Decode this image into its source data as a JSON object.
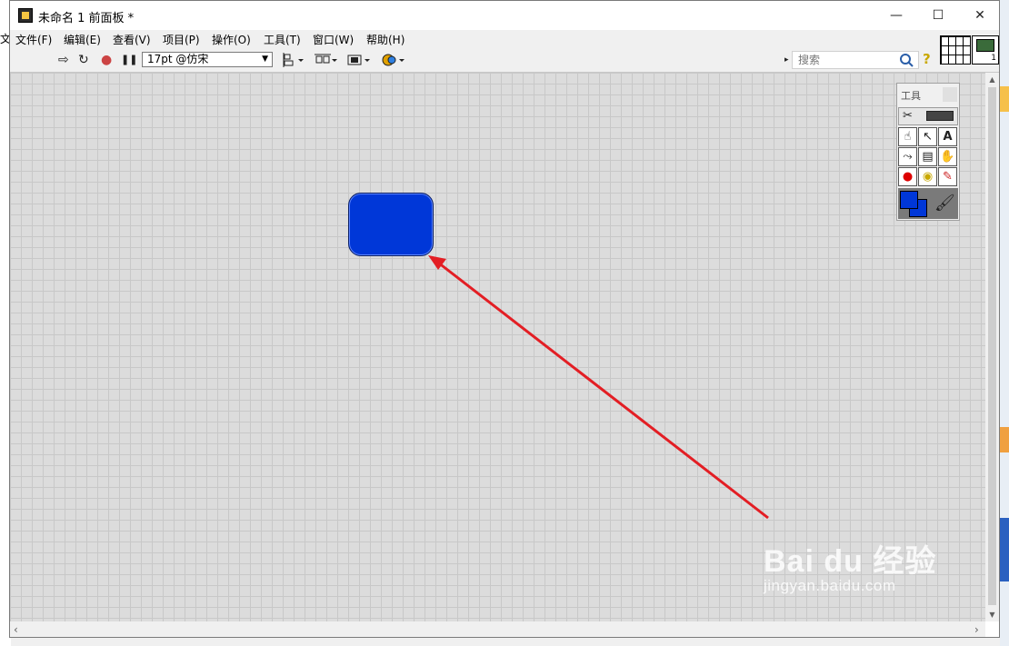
{
  "window": {
    "title": "未命名 1 前面板 *",
    "controls": {
      "minimize": "—",
      "maximize": "☐",
      "close": "✕"
    }
  },
  "menubar": {
    "items": [
      {
        "label": "文件(F)"
      },
      {
        "label": "编辑(E)"
      },
      {
        "label": "查看(V)"
      },
      {
        "label": "项目(P)"
      },
      {
        "label": "操作(O)"
      },
      {
        "label": "工具(T)"
      },
      {
        "label": "窗口(W)"
      },
      {
        "label": "帮助(H)"
      }
    ]
  },
  "toolbar": {
    "run_icon": "⇨",
    "run_continuous_icon": "↻",
    "abort_icon": "●",
    "pause_icon": "❚❚",
    "font_select": "17pt @仿宋",
    "align_icon": "align-objects-icon",
    "distribute_icon": "distribute-objects-icon",
    "resize_icon": "resize-objects-icon",
    "reorder_icon": "reorder-icon",
    "search_placeholder": "搜索",
    "help_icon": "?"
  },
  "tools_palette": {
    "title": "工具",
    "tools": [
      "operate-value-tool",
      "position-select-tool",
      "edit-text-tool",
      "connect-wire-tool",
      "object-shortcut-menu-tool",
      "scroll-window-tool",
      "breakpoint-tool",
      "probe-tool",
      "get-color-tool"
    ],
    "foreground_color": "#0037d8",
    "background_color": "#0037d8"
  },
  "canvas": {
    "grid_color": "#c8c8c8",
    "background_color": "#dcdcdc",
    "shape_color": "#0037d8",
    "annotation_arrow_color": "#e31e24"
  },
  "watermark": {
    "logo": "Bai du 经验",
    "url": "jingyan.baidu.com"
  },
  "desktop_fragment": {
    "left_text": "文"
  }
}
